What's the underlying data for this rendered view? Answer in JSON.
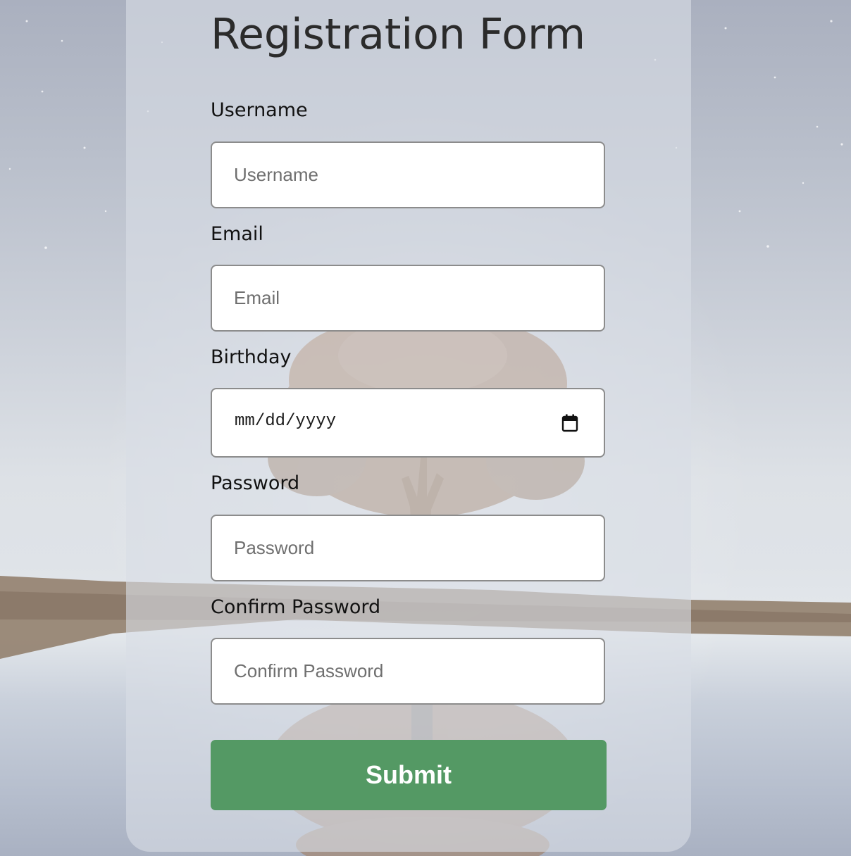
{
  "form": {
    "title": "Registration Form",
    "fields": [
      {
        "label": "Username",
        "placeholder": "Username",
        "type": "text"
      },
      {
        "label": "Email",
        "placeholder": "Email",
        "type": "email"
      },
      {
        "label": "Birthday",
        "placeholder": "mm/dd/yyyy",
        "type": "date"
      },
      {
        "label": "Password",
        "placeholder": "Password",
        "type": "password"
      },
      {
        "label": "Confirm Password",
        "placeholder": "Confirm Password",
        "type": "password"
      }
    ],
    "submit_label": "Submit"
  },
  "icons": {
    "date_picker": "calendar-icon"
  },
  "colors": {
    "submit_button": "#549964",
    "title_text": "#2b2b2b",
    "field_border": "#8c8c8c"
  }
}
